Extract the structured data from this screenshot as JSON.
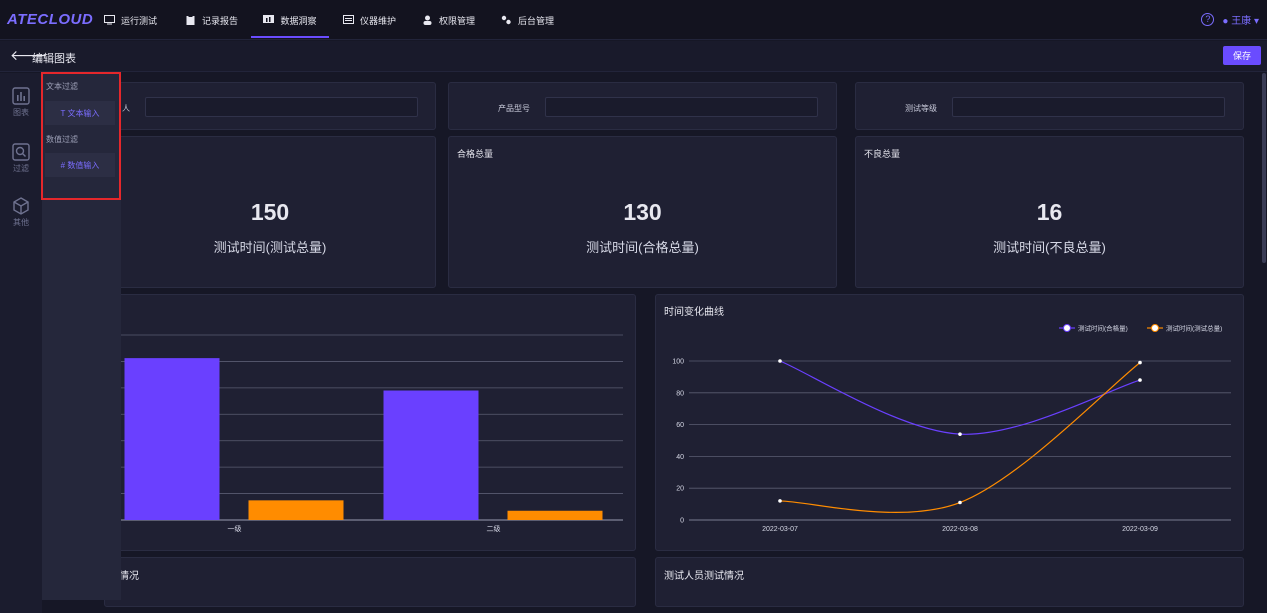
{
  "app": {
    "logo": "ATECLOUD"
  },
  "nav": [
    {
      "label": "运行测试"
    },
    {
      "label": "记录报告"
    },
    {
      "label": "数据洞察"
    },
    {
      "label": "仪器维护"
    },
    {
      "label": "权限管理"
    },
    {
      "label": "后台管理"
    }
  ],
  "user": {
    "name": "王康",
    "help_icon": "question-circle-icon"
  },
  "subheader": {
    "title": "编辑图表",
    "save_label": "保存"
  },
  "rail": [
    {
      "label": "图表",
      "icon": "bar-chart-icon"
    },
    {
      "label": "过滤",
      "icon": "search-icon"
    },
    {
      "label": "其他",
      "icon": "cube-icon"
    }
  ],
  "filter_panel": {
    "text_section": "文本过滤",
    "text_button": "T 文本输入",
    "number_section": "数值过滤",
    "number_button": "# 数值输入"
  },
  "filters": [
    {
      "label": "人",
      "value": ""
    },
    {
      "label": "产品型号",
      "value": ""
    },
    {
      "label": "测试等级",
      "value": ""
    }
  ],
  "kpis": [
    {
      "title": "",
      "value": "150",
      "label": "测试时间(测试总量)"
    },
    {
      "title": "合格总量",
      "value": "130",
      "label": "测试时间(合格总量)"
    },
    {
      "title": "不良总量",
      "value": "16",
      "label": "测试时间(不良总量)"
    }
  ],
  "bottom": {
    "left_title": "情况",
    "right_title": "测试人员测试情况"
  },
  "colors": {
    "accent": "#6a4cff",
    "series_a": "#6a40ff",
    "series_b": "#ff8c00"
  },
  "chart_data": [
    {
      "type": "bar",
      "title": "",
      "categories": [
        "一级",
        "二级"
      ],
      "series": [
        {
          "values": [
            70,
            56
          ]
        },
        {
          "values": [
            8.5,
            4
          ]
        }
      ],
      "ylim": [
        0,
        80
      ],
      "grid": true
    },
    {
      "type": "line",
      "title": "时间变化曲线",
      "x": [
        "2022-03-07",
        "2022-03-08",
        "2022-03-09"
      ],
      "series": [
        {
          "name": "测试时间(合格量)",
          "values": [
            100,
            54,
            88
          ]
        },
        {
          "name": "测试时间(测试总量)",
          "values": [
            12,
            11,
            99
          ]
        }
      ],
      "yticks": [
        "0",
        "20",
        "40",
        "60",
        "80",
        "100"
      ],
      "ylim": [
        0,
        100
      ],
      "legend": "top-right",
      "grid": true
    }
  ]
}
